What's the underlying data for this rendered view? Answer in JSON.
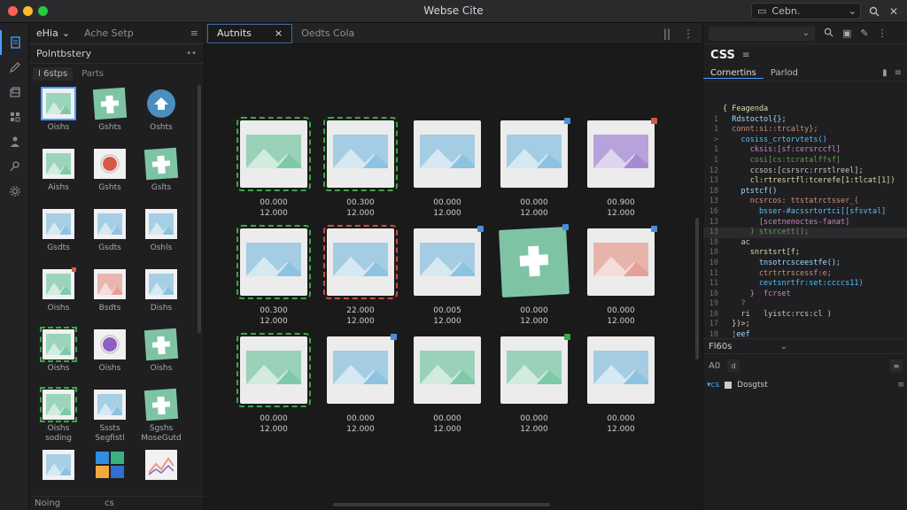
{
  "window": {
    "title": "Webse Cite"
  },
  "titlebar": {
    "search_text": "Cebn.",
    "search_caret": "⌄",
    "icons": [
      "search-icon",
      "close-icon"
    ]
  },
  "activity": {
    "icons": [
      "files-icon",
      "edit-icon",
      "layers-icon",
      "extensions-icon",
      "person-icon",
      "search-people-icon",
      "settings-icon"
    ]
  },
  "left_panel": {
    "tabs": [
      {
        "label": "eHia",
        "caret": "⌄"
      },
      {
        "label": "Ache Setp"
      }
    ],
    "menu": "≡",
    "header": {
      "title": "Polntbstery",
      "dots": "••"
    },
    "subtabs": [
      "I 6stps",
      "Parts"
    ],
    "assets": [
      {
        "label": "Oishs",
        "kind": "image",
        "color": "#7ecaa8",
        "bg": "#f1f1f1",
        "selected": true
      },
      {
        "label": "Gshts",
        "kind": "puzzle",
        "color": "#7ec4a4",
        "bg": "#7ec4a4"
      },
      {
        "label": "Oshts",
        "kind": "pin",
        "color": "#4a8fbf",
        "bg": "transparent"
      },
      {
        "label": "Aishs",
        "kind": "image",
        "color": "#7ecaa8",
        "bg": "#f1f1f1"
      },
      {
        "label": "Gshts",
        "kind": "badge-red",
        "color": "#d65a4a",
        "bg": "#f1f1f1"
      },
      {
        "label": "Gslts",
        "kind": "puzzle",
        "color": "#7ec4a4",
        "bg": "#7ec4a4"
      },
      {
        "label": "Gsdts",
        "kind": "image",
        "color": "#8cc3e0",
        "bg": "#f1f1f1"
      },
      {
        "label": "Gsdts",
        "kind": "image",
        "color": "#8cc3e0",
        "bg": "#f1f1f1"
      },
      {
        "label": "Oshls",
        "kind": "image",
        "color": "#8cc3e0",
        "bg": "#f1f1f1"
      },
      {
        "label": "Oishs",
        "kind": "image",
        "color": "#7ecaa8",
        "bg": "#f1f1f1",
        "corner": "#d65a4a"
      },
      {
        "label": "Bsdts",
        "kind": "image",
        "color": "#e6a197",
        "bg": "#f1f1f1"
      },
      {
        "label": "Dishs",
        "kind": "image",
        "color": "#8cc3e0",
        "bg": "#f1f1f1"
      },
      {
        "label": "Oishs",
        "kind": "image",
        "color": "#7ecaa8",
        "bg": "#f1f1f1",
        "dashed": true
      },
      {
        "label": "Oishs",
        "kind": "badge-purple",
        "color": "#8d5fc3",
        "bg": "#f1f1f1"
      },
      {
        "label": "Oishs",
        "kind": "puzzle",
        "color": "#7ec4a4",
        "bg": "#7ec4a4"
      },
      {
        "label": "Oishs\nsoding",
        "kind": "image",
        "color": "#7ecaa8",
        "bg": "#f1f1f1",
        "dashed": true
      },
      {
        "label": "Sssts\nSegfistl",
        "kind": "image",
        "color": "#8cc3e0",
        "bg": "#f1f1f1"
      },
      {
        "label": "Sgshs\nMoseGutd",
        "kind": "puzzle",
        "color": "#7ec4a4",
        "bg": "#7ec4a4"
      },
      {
        "label": "",
        "kind": "image",
        "color": "#8cc3e0",
        "bg": "#f1f1f1"
      },
      {
        "label": "",
        "kind": "tiles",
        "color": "#3b7fd0",
        "bg": "transparent"
      },
      {
        "label": "",
        "kind": "chart",
        "color": "#e39a8a",
        "bg": "#f1f1f1"
      }
    ],
    "footer": {
      "left": "Noing",
      "right": "cs"
    }
  },
  "center": {
    "tabs": [
      {
        "label": "Autnits",
        "close": "×",
        "active": true
      },
      {
        "label": "Oedts Cola",
        "active": false
      }
    ],
    "tools": [
      "||",
      "⋮"
    ],
    "cards": [
      {
        "v1": "00.000",
        "v2": "12.000",
        "color": "#7ecaa8",
        "frame": "dashed-g",
        "corner": ""
      },
      {
        "v1": "00.300",
        "v2": "12.000",
        "color": "#8cc3e0",
        "frame": "dashed-g",
        "corner": ""
      },
      {
        "v1": "00.000",
        "v2": "12.000",
        "color": "#8cc3e0",
        "frame": "",
        "corner": ""
      },
      {
        "v1": "00.000",
        "v2": "12.000",
        "color": "#8cc3e0",
        "frame": "",
        "corner": "#4a90d9"
      },
      {
        "v1": "00.900",
        "v2": "12.000",
        "color": "#a68ad6",
        "frame": "",
        "corner": "#d65a4a"
      },
      {
        "v1": "00.300",
        "v2": "12.000",
        "color": "#8cc3e0",
        "frame": "dashed-g",
        "corner": ""
      },
      {
        "v1": "22.000",
        "v2": "12.000",
        "color": "#8cc3e0",
        "frame": "dashed-r",
        "corner": ""
      },
      {
        "v1": "00.005",
        "v2": "12.000",
        "color": "#8cc3e0",
        "frame": "",
        "corner": "#4a90d9"
      },
      {
        "v1": "00.000",
        "v2": "12.000",
        "color": "#7ec4a4",
        "frame": "",
        "corner": "#4a90d9",
        "puzzle": true
      },
      {
        "v1": "00.000",
        "v2": "12.000",
        "color": "#e6a197",
        "frame": "",
        "corner": "#4a90d9"
      },
      {
        "v1": "00.000",
        "v2": "12.000",
        "color": "#7ecaa8",
        "frame": "dashed-g",
        "corner": ""
      },
      {
        "v1": "00.000",
        "v2": "12.000",
        "color": "#8cc3e0",
        "frame": "",
        "corner": "#4a90d9"
      },
      {
        "v1": "00.000",
        "v2": "12.000",
        "color": "#7ecaa8",
        "frame": "",
        "corner": ""
      },
      {
        "v1": "00.000",
        "v2": "12.000",
        "color": "#7ecaa8",
        "frame": "",
        "corner": "#3aa844"
      },
      {
        "v1": "00.000",
        "v2": "12.000",
        "color": "#8cc3e0",
        "frame": "",
        "corner": ""
      }
    ]
  },
  "right_panel": {
    "select_caret": "⌄",
    "top_icons": [
      "search-icon",
      "copy-icon",
      "pin-icon",
      "more-icon"
    ],
    "title": "CSS",
    "title_menu": "≡",
    "subtabs": [
      "Cornertins",
      "Parlod"
    ],
    "code_lines": [
      {
        "n": "",
        "t": "{ Feagenda"
      },
      {
        "n": "1",
        "t": "  Rdstoctol{};"
      },
      {
        "n": "1",
        "t": "  connt:si::trcalty};"
      },
      {
        "n": ">",
        "t": "    cosiss_crtorvtets()"
      },
      {
        "n": "1",
        "t": "      cksis:[sf:cersrccfl]"
      },
      {
        "n": "1",
        "t": "      cosi[cs:tcratalffsf]"
      },
      {
        "n": "12",
        "t": "      ccsos:[csrsrc:rrstlreel];"
      },
      {
        "n": "13",
        "t": "      cl:rtresrtfl:tcerefe[1:tlcat[1])"
      },
      {
        "n": "18",
        "t": "    ptstcf()"
      },
      {
        "n": "13",
        "t": "      ncsrcos: ttstatrctsser_("
      },
      {
        "n": "16",
        "t": "        bsser-#acssrtortci[[sfsvtal]"
      },
      {
        "n": "13",
        "t": "        [scetnenoctes-fanat]"
      },
      {
        "n": "13",
        "t": "      ) stsrcett();"
      },
      {
        "n": "18",
        "t": "    ac"
      },
      {
        "n": "18",
        "t": "      snrstsrt[f;"
      },
      {
        "n": "10",
        "t": "        tnsotrcsceestfe();"
      },
      {
        "n": "11",
        "t": "        ctrtrtrscessf:e;"
      },
      {
        "n": "11",
        "t": "        cevtsnrtfr:set:ccccs11)"
      },
      {
        "n": "10",
        "t": "      }  fcrset"
      },
      {
        "n": "19",
        "t": "    ?"
      },
      {
        "n": "10",
        "t": "    ri   lyistc:rcs:cl )"
      },
      {
        "n": "17",
        "t": "  })>;"
      },
      {
        "n": "10",
        "t": "  ¦eef"
      }
    ],
    "split": {
      "title": "Fl60s",
      "caret": "⌄"
    },
    "tools2": {
      "left": "A0",
      "chip": "d",
      "right": "≡"
    },
    "row": {
      "label": "▾cs",
      "text": "Dosgtst",
      "right": "≡"
    }
  }
}
